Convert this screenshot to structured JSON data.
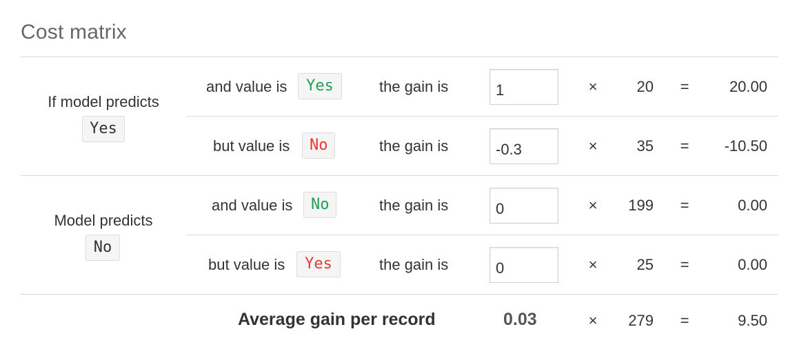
{
  "title": "Cost matrix",
  "groups": [
    {
      "label": "If model predicts",
      "predicted": "Yes"
    },
    {
      "label": "Model predicts",
      "predicted": "No"
    }
  ],
  "rows": [
    {
      "prefix": "and value is",
      "actual": "Yes",
      "actual_color": "#1fa055",
      "gain_label": "the gain is",
      "gain": "1",
      "times": "×",
      "count": "20",
      "equals": "=",
      "result": "20.00"
    },
    {
      "prefix": "but value is",
      "actual": "No",
      "actual_color": "#e53935",
      "gain_label": "the gain is",
      "gain": "-0.3",
      "times": "×",
      "count": "35",
      "equals": "=",
      "result": "-10.50"
    },
    {
      "prefix": "and value is",
      "actual": "No",
      "actual_color": "#1fa055",
      "gain_label": "the gain is",
      "gain": "0",
      "times": "×",
      "count": "199",
      "equals": "=",
      "result": "0.00"
    },
    {
      "prefix": "but value is",
      "actual": "Yes",
      "actual_color": "#e53935",
      "gain_label": "the gain is",
      "gain": "0",
      "times": "×",
      "count": "25",
      "equals": "=",
      "result": "0.00"
    }
  ],
  "summary": {
    "label": "Average gain per record",
    "average": "0.03",
    "times": "×",
    "count": "279",
    "equals": "=",
    "total": "9.50"
  }
}
